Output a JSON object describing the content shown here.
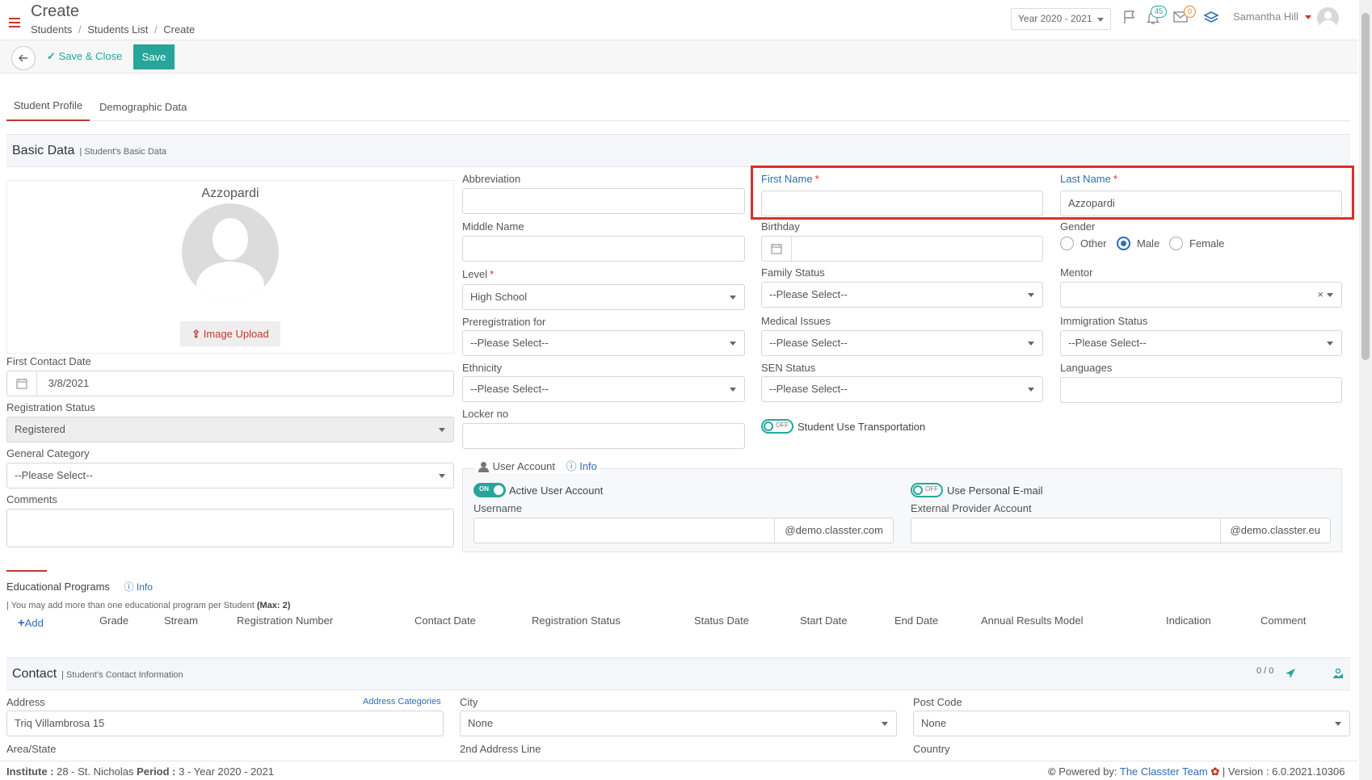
{
  "header": {
    "title": "Create",
    "breadcrumb": [
      "Students",
      "Students List",
      "Create"
    ],
    "year_select": "Year 2020 - 2021",
    "notifications_count": "45",
    "messages_count": "0",
    "user_name": "Samantha Hill"
  },
  "toolbar": {
    "save_close_label": "Save & Close",
    "save_label": "Save"
  },
  "tabs": [
    "Student Profile",
    "Demographic Data"
  ],
  "basic": {
    "title": "Basic Data",
    "subtitle": "| Student's Basic Data",
    "display_name": "Azzopardi",
    "image_upload": "Image Upload",
    "first_contact_date_label": "First Contact Date",
    "first_contact_date_value": "3/8/2021",
    "registration_status_label": "Registration Status",
    "registration_status_value": "Registered",
    "general_category_label": "General Category",
    "general_category_value": "--Please Select--",
    "comments_label": "Comments",
    "abbreviation_label": "Abbreviation",
    "middle_name_label": "Middle Name",
    "level_label": "Level",
    "level_value": "High School",
    "preregistration_label": "Preregistration for",
    "preregistration_value": "--Please Select--",
    "ethnicity_label": "Ethnicity",
    "ethnicity_value": "--Please Select--",
    "locker_label": "Locker no",
    "first_name_label": "First Name",
    "last_name_label": "Last Name",
    "last_name_value": "Azzopardi",
    "birthday_label": "Birthday",
    "gender_label": "Gender",
    "gender_options": [
      "Other",
      "Male",
      "Female"
    ],
    "family_status_label": "Family Status",
    "family_status_value": "--Please Select--",
    "mentor_label": "Mentor",
    "medical_label": "Medical Issues",
    "medical_value": "--Please Select--",
    "immigration_label": "Immigration Status",
    "immigration_value": "--Please Select--",
    "sen_label": "SEN Status",
    "sen_value": "--Please Select--",
    "languages_label": "Languages",
    "transport_toggle": "OFF",
    "transport_label": "Student Use Transportation"
  },
  "user_account": {
    "title": "User Account",
    "info": "Info",
    "active_toggle": "ON",
    "active_label": "Active User Account",
    "personal_toggle": "OFF",
    "personal_label": "Use Personal E-mail",
    "username_label": "Username",
    "username_suffix": "@demo.classter.com",
    "external_label": "External Provider Account",
    "external_suffix": "@demo.classter.eu"
  },
  "programs": {
    "title": "Educational Programs",
    "info": "Info",
    "note_prefix": "| You may add more than one educational program per Student ",
    "note_max": "(Max: 2)",
    "add": "Add",
    "columns": [
      "Grade",
      "Stream",
      "Registration Number",
      "Contact Date",
      "Registration Status",
      "Status Date",
      "Start Date",
      "End Date",
      "Annual Results Model",
      "Indication",
      "Comment"
    ]
  },
  "contact": {
    "title": "Contact",
    "subtitle": "| Student's Contact Information",
    "counter": "0 / 0",
    "address_label": "Address",
    "address_categories": "Address Categories",
    "address_value": "Triq Villambrosa 15",
    "city_label": "City",
    "city_value": "None",
    "postcode_label": "Post Code",
    "postcode_value": "None",
    "area_label": "Area/State",
    "address2_label": "2nd Address Line",
    "country_label": "Country"
  },
  "footer": {
    "institute_label": "Institute :",
    "institute_value": " 28 - St. Nicholas ",
    "period_label": "Period :",
    "period_value": " 3 - Year 2020 - 2021",
    "powered": "Powered by:",
    "team": "The Classter Team",
    "version": "| Version : 6.0.2021.10306"
  },
  "colors": {
    "accent": "#26a69a",
    "highlight": "#d9302c",
    "link": "#2f6db5"
  }
}
